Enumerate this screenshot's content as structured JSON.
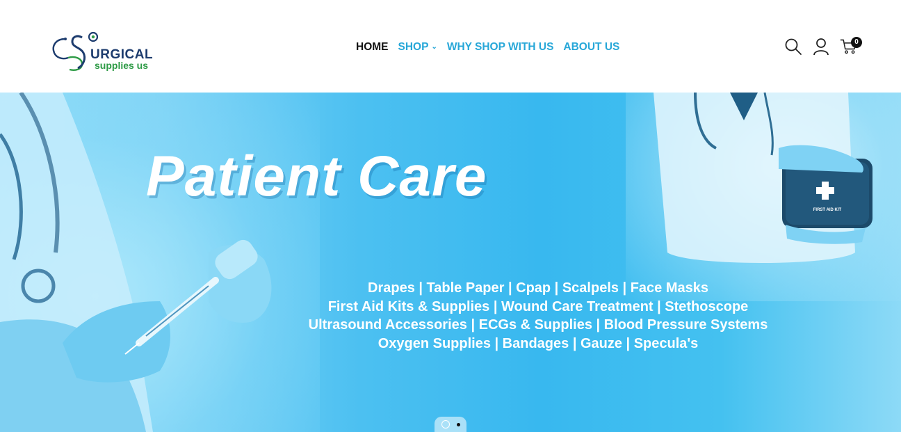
{
  "brand": {
    "word": "URGICAL",
    "sub": "supplies us"
  },
  "nav": {
    "items": [
      {
        "label": "HOME",
        "active": true
      },
      {
        "label": "SHOP",
        "has_dropdown": true
      },
      {
        "label": "WHY SHOP WITH US"
      },
      {
        "label": "ABOUT US"
      }
    ]
  },
  "header_icons": {
    "search": "search-icon",
    "account": "user-icon",
    "cart": "cart-icon",
    "cart_count": "0"
  },
  "hero": {
    "title": "Patient Care",
    "lines": [
      "Drapes | Table Paper | Cpap | Scalpels | Face Masks",
      "First Aid Kits & Supplies | Wound Care Treatment | Stethoscope",
      "Ultrasound Accessories | ECGs & Supplies | Blood Pressure Systems",
      "Oxygen Supplies | Bandages | Gauze | Specula's"
    ],
    "kit_label": "FIRST AID KIT",
    "slides_total": 2,
    "active_slide": 2
  },
  "colors": {
    "accent": "#27a7d8",
    "nav_active": "#111111",
    "brand_blue": "#1d3c6e",
    "brand_green": "#2e9b46",
    "hero_blue": "#38b8ef"
  }
}
